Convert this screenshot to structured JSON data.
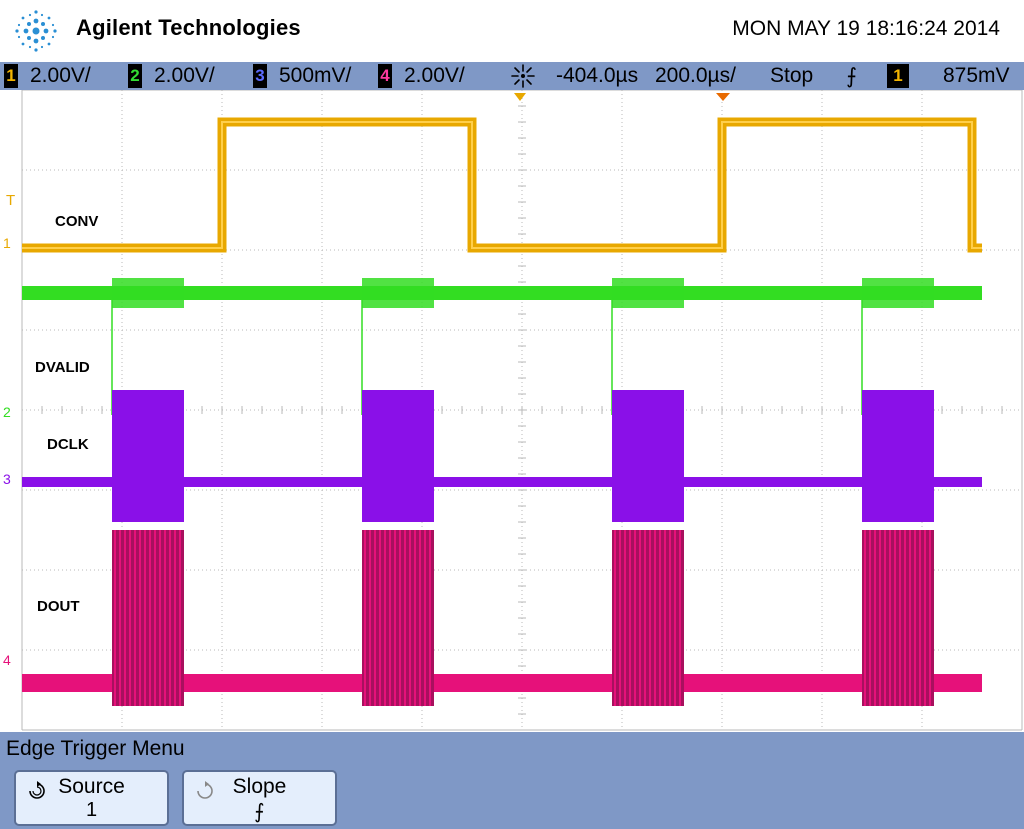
{
  "header": {
    "brand": "Agilent Technologies",
    "datetime": "MON MAY 19 18:16:24 2014"
  },
  "status": {
    "channels": [
      {
        "num": "1",
        "scale": "2.00V/",
        "color": "#f3b400"
      },
      {
        "num": "2",
        "scale": "2.00V/",
        "color": "#33dd33"
      },
      {
        "num": "3",
        "scale": "500mV/",
        "color": "#5c6cff"
      },
      {
        "num": "4",
        "scale": "2.00V/",
        "color": "#ff3aa0"
      }
    ],
    "delay": "-404.0µs",
    "timebase": "200.0µs/",
    "run_state": "Stop",
    "trigger_slope_glyph": "⨍",
    "trigger_source": "1",
    "trigger_level": "875mV",
    "icons": {
      "delay": "sun-burst-icon",
      "slope": "rising-edge-icon"
    }
  },
  "display": {
    "signal_labels": {
      "conv": "CONV",
      "dvalid": "DVALID",
      "dclk": "DCLK",
      "dout": "DOUT"
    },
    "markers": {
      "trigger": "T",
      "ch1": "1",
      "ch2": "2",
      "ch3": "3",
      "ch4": "4"
    },
    "trace_colors": {
      "conv": "#e8a800",
      "dvalid": "#33dd22",
      "dclk": "#8a10e8",
      "dout": "#e6117a"
    },
    "grid_color": "#b8b8b8"
  },
  "menu": {
    "title": "Edge Trigger Menu",
    "softkeys": [
      {
        "label": "Source",
        "value": "1",
        "icon": "rotate-knob-icon"
      },
      {
        "label": "Slope",
        "value": "⨍",
        "icon": "rotate-knob-icon"
      }
    ]
  }
}
